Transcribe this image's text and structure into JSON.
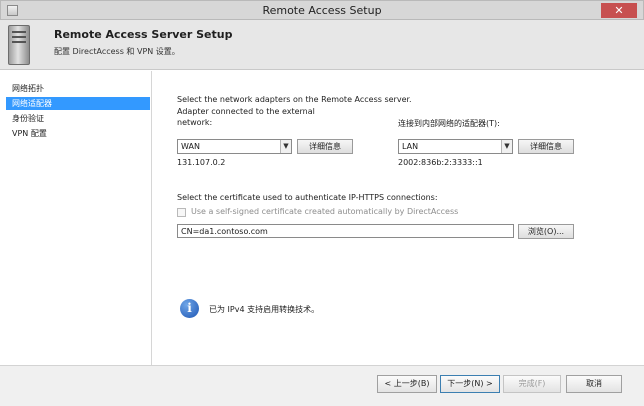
{
  "window": {
    "title": "Remote Access Setup",
    "close_glyph": "✕"
  },
  "header": {
    "title": "Remote Access Server Setup",
    "subtitle": "配置 DirectAccess 和 VPN 设置。"
  },
  "nav": {
    "items": [
      {
        "label": "网络拓扑",
        "active": false
      },
      {
        "label": "网络适配器",
        "active": true
      },
      {
        "label": "身份验证",
        "active": false
      },
      {
        "label": "VPN 配置",
        "active": false
      }
    ]
  },
  "main": {
    "instruction": "Select the network adapters on the Remote Access server.",
    "external": {
      "label_line1": "Adapter connected to the external",
      "label_line2": "network:",
      "value": "WAN",
      "details_label": "详细信息",
      "address": "131.107.0.2"
    },
    "internal": {
      "label": "连接到内部网络的适配器(T):",
      "value": "LAN",
      "details_label": "详细信息",
      "address": "2002:836b:2:3333::1"
    },
    "certificate": {
      "label": "Select the certificate used to authenticate IP-HTTPS connections:",
      "self_signed_label": "Use a self-signed certificate created automatically by DirectAccess",
      "self_signed_checked": false,
      "value": "CN=da1.contoso.com",
      "browse_label": "浏览(O)..."
    },
    "info": {
      "icon_glyph": "i",
      "text": "已为 IPv4 支持启用转换技术。"
    }
  },
  "footer": {
    "back_label": "< 上一步(B)",
    "next_label": "下一步(N) >",
    "finish_label": "完成(F)",
    "cancel_label": "取消"
  },
  "colors": {
    "nav_active": "#3399ff",
    "titlebar": "#d7d7d7",
    "header": "#e7e7e7",
    "info_icon": "#1d55b3"
  }
}
